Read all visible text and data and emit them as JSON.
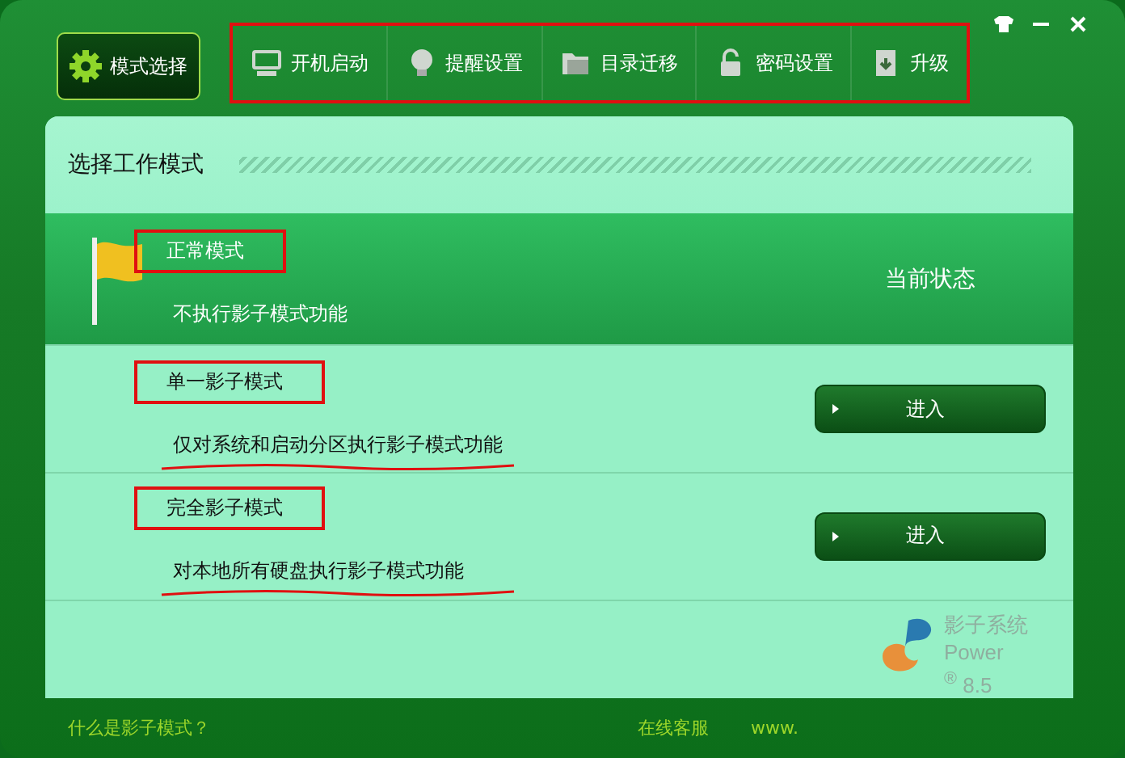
{
  "nav": {
    "mode_tab": {
      "label": "模式选择",
      "selected": true
    },
    "items": [
      {
        "label": "开机启动",
        "kind": "monitor"
      },
      {
        "label": "提醒设置",
        "kind": "bulb"
      },
      {
        "label": "目录迁移",
        "kind": "folder"
      },
      {
        "label": "密码设置",
        "kind": "lock"
      },
      {
        "label": "升级",
        "kind": "upgrade"
      }
    ]
  },
  "panel": {
    "title": "选择工作模式"
  },
  "modes": [
    {
      "name": "正常模式",
      "description": "不执行影子模式功能",
      "selected": true,
      "status": "当前状态",
      "underlined": false
    },
    {
      "name": "单一影子模式",
      "description": "仅对系统和启动分区执行影子模式功能",
      "selected": false,
      "button": "进入",
      "underlined": true
    },
    {
      "name": "完全影子模式",
      "description": "对本地所有硬盘执行影子模式功能",
      "selected": false,
      "button": "进入",
      "underlined": true
    }
  ],
  "logo": {
    "name": "影子系统",
    "sub": "Power",
    "version": "$^{®}$ 8.5"
  },
  "footer": {
    "help_link": "什么是影子模式？",
    "service_link": "在线客服",
    "site_link": "www."
  }
}
